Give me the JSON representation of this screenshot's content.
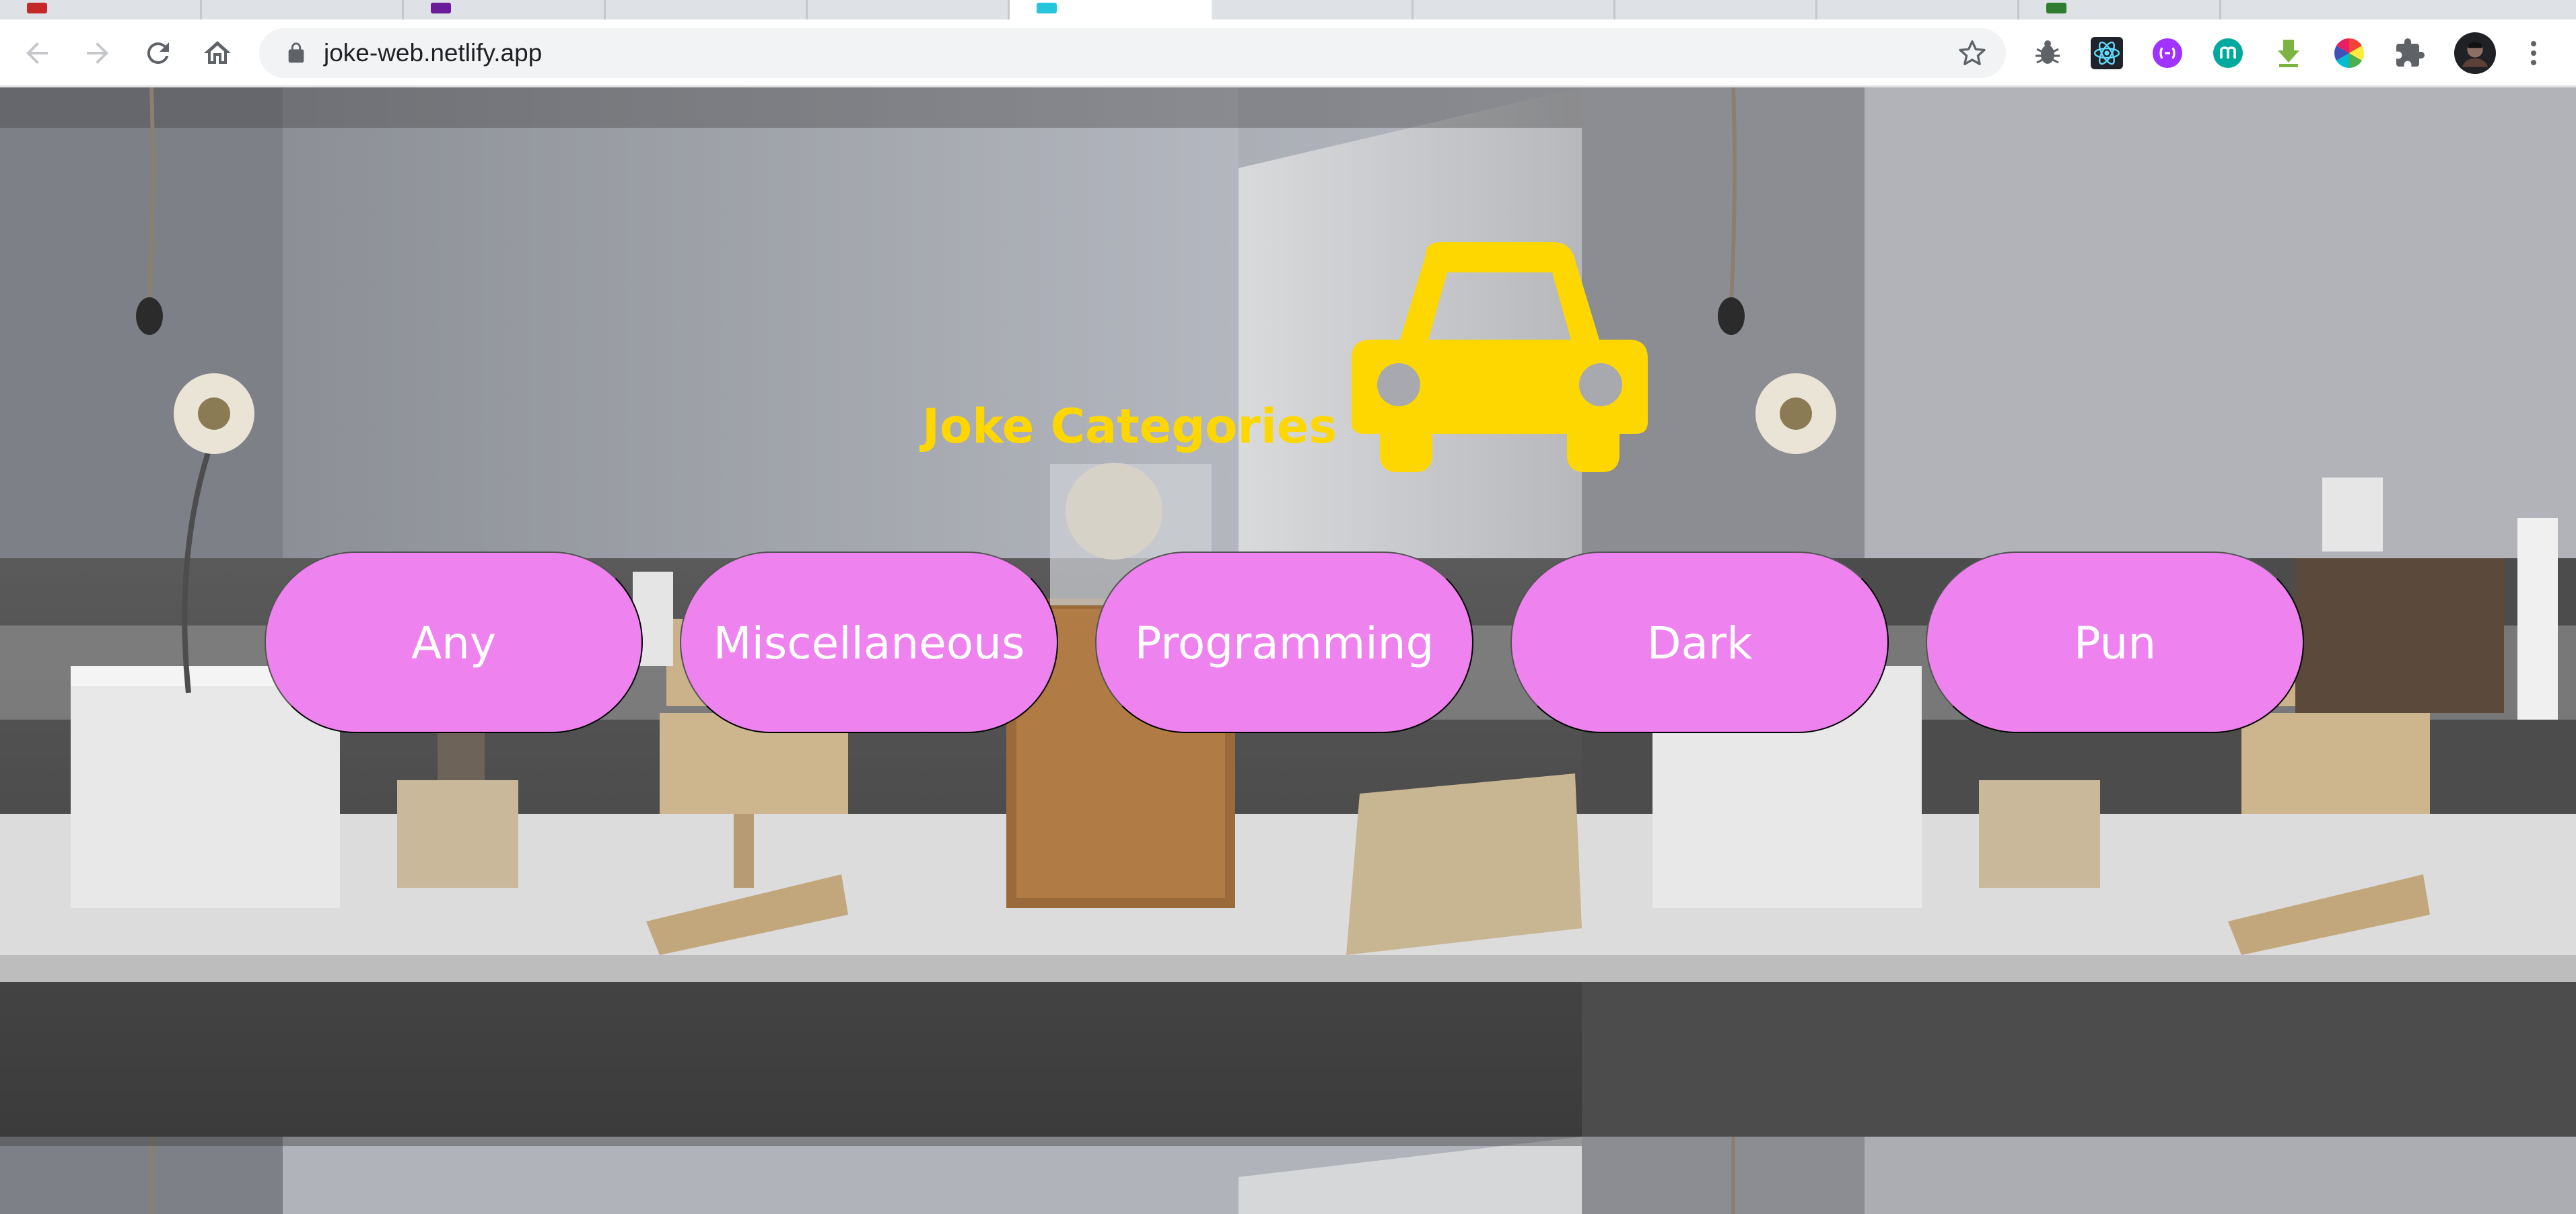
{
  "browser": {
    "url": "joke-web.netlify.app",
    "tab_count": 12,
    "active_tab_index": 5
  },
  "colors": {
    "title": "#ffd700",
    "car_icon": "#ffd700",
    "button_bg": "#ee82ee",
    "button_text": "#ffffff",
    "chrome_bg": "#dee1e6",
    "omnibox_bg": "#f1f3f4"
  },
  "toolbar": {
    "back_icon": "arrow-left-icon",
    "forward_icon": "arrow-right-icon",
    "reload_icon": "reload-icon",
    "home_icon": "home-icon",
    "bookmark_icon": "star-icon",
    "extensions": [
      {
        "name": "bug-extension-icon",
        "color": "#5f6368"
      },
      {
        "name": "react-devtools-icon",
        "color": "#61dafb"
      },
      {
        "name": "purple-extension-icon",
        "color": "#a033ff"
      },
      {
        "name": "teal-m-extension-icon",
        "color": "#00a99d"
      },
      {
        "name": "green-download-icon",
        "color": "#7cb342"
      },
      {
        "name": "color-wheel-icon",
        "color": "#e91e63"
      },
      {
        "name": "puzzle-icon",
        "color": "#5f6368"
      },
      {
        "name": "profile-avatar",
        "color": "#202124"
      },
      {
        "name": "kebab-menu-icon",
        "color": "#5f6368"
      }
    ]
  },
  "page": {
    "title": "Joke Categories",
    "logo_icon": "car-icon",
    "categories": [
      "Any",
      "Miscellaneous",
      "Programming",
      "Dark",
      "Pun"
    ]
  }
}
